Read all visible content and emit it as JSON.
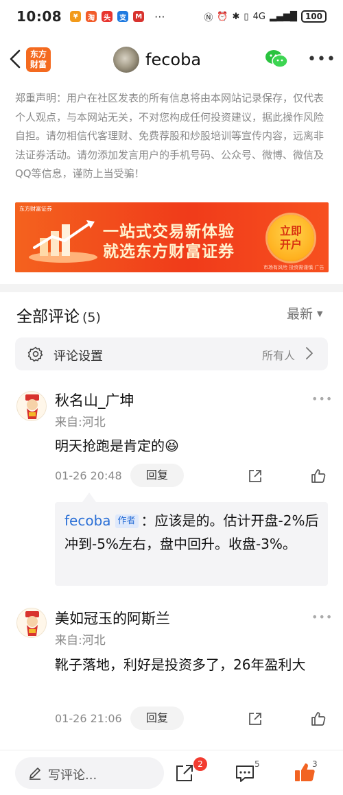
{
  "status_bar": {
    "time": "10:08",
    "network": "4G",
    "battery": "100"
  },
  "header": {
    "brand_logo": [
      "东方",
      "财富"
    ],
    "user_name": "fecoba"
  },
  "disclaimer": "郑重声明：用户在社区发表的所有信息将由本网站记录保存，仅代表个人观点，与本网站无关，不对您构成任何投资建议，据此操作风险自担。请勿相信代客理财、免费荐股和炒股培训等宣传内容，远离非法证券活动。请勿添加发言用户的手机号码、公众号、微博、微信及QQ等信息，谨防上当受骗！",
  "banner": {
    "brand": "东方财富证券",
    "line1": "一站式交易新体验",
    "line2": "就选东方财富证券",
    "cta": [
      "立即",
      "开户"
    ],
    "risk": "市场有风险 投资需谨慎 广告"
  },
  "comments_section": {
    "title": "全部评论",
    "count": "(5)",
    "sort": "最新",
    "settings_label": "评论设置",
    "settings_value": "所有人"
  },
  "comments": [
    {
      "name": "秋名山_广坤",
      "from": "来自:河北",
      "body": "明天抢跑是肯定的😆",
      "time": "01-26 20:48",
      "reply_label": "回复",
      "reply": {
        "author": "fecoba",
        "tag": "作者",
        "text": "：应该是的。估计开盘-2%后冲到-5%左右，盘中回升。收盘-3%。"
      }
    },
    {
      "name": "美如冠玉的阿斯兰",
      "from": "来自:河北",
      "body": "靴子落地，利好是投资多了，26年盈利大",
      "time": "01-26 21:06",
      "reply_label": "回复"
    }
  ],
  "bottom_bar": {
    "write_label": "写评论...",
    "share_badge": "2",
    "comment_count": "5",
    "like_count": "3"
  },
  "colors": {
    "brand_orange": "#f46a1f",
    "author_blue": "#2a6fd6",
    "badge_red": "#f23b30"
  }
}
